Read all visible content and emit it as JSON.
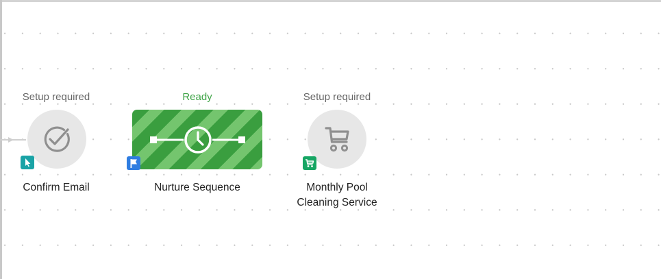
{
  "nodes": [
    {
      "status": "Setup required",
      "name": "Confirm Email",
      "icon": "check-circle-icon",
      "badge_icon": "cursor-pointer-icon",
      "badge_color": "#1aa3a6"
    },
    {
      "status": "Ready",
      "name": "Nurture Sequence",
      "icon": "clock-timeline-icon",
      "badge_icon": "flag-icon",
      "badge_color": "#2f7de1"
    },
    {
      "status": "Setup required",
      "name_lines": [
        "Monthly Pool",
        "Cleaning Service"
      ],
      "icon": "shopping-cart-icon",
      "badge_icon": "shopping-cart-icon",
      "badge_color": "#17a664"
    }
  ],
  "colors": {
    "ready": "#3fa447",
    "setup_required": "#666666",
    "box_stripe_dark": "#3a9e3f",
    "box_stripe_light": "#74c56e",
    "node_circle": "#e7e7e7",
    "node_icon": "#8f8f8f"
  }
}
